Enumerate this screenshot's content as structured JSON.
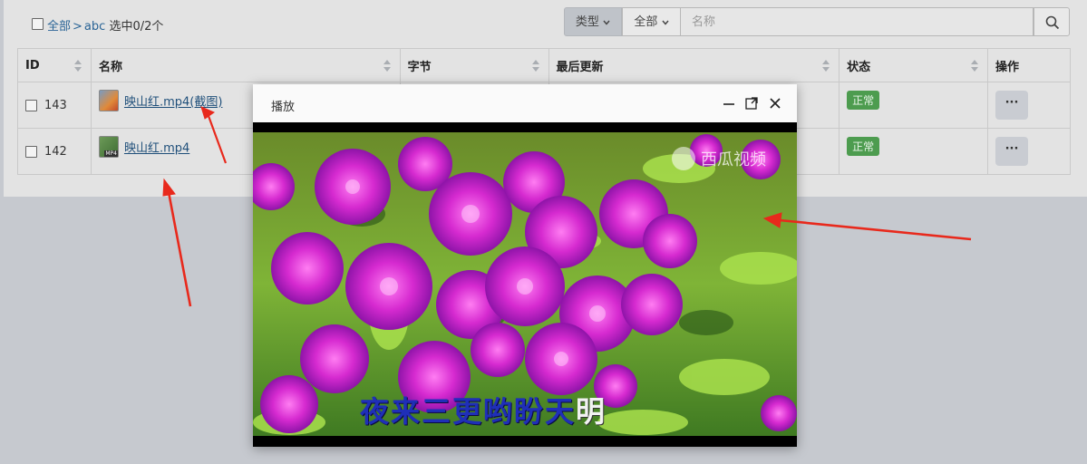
{
  "toolbar": {
    "breadcrumb_all": "全部",
    "breadcrumb_sep": ">",
    "breadcrumb_folder": "abc",
    "selection_status": "选中0/2个",
    "type_filter": "类型",
    "scope_filter": "全部",
    "search_placeholder": "名称"
  },
  "table": {
    "headers": [
      "ID",
      "名称",
      "字节",
      "最后更新",
      "状态",
      "操作"
    ],
    "rows": [
      {
        "id": "143",
        "name": "映山红.mp4(截图)",
        "status": "正常",
        "action": "···",
        "icon": "image-file-icon"
      },
      {
        "id": "142",
        "name": "映山红.mp4",
        "status": "正常",
        "action": "···",
        "icon": "mp4-file-icon"
      }
    ]
  },
  "modal": {
    "title": "播放",
    "video_subtitle_dim": "夜来三更哟盼天",
    "video_subtitle_bright": "明",
    "watermark": "西瓜视频"
  },
  "icons": {
    "search": "search-icon",
    "minimize": "minimize-icon",
    "maximize": "maximize-icon",
    "close": "close-icon",
    "dropdown": "chevron-down-icon"
  },
  "colors": {
    "link": "#2a6496",
    "status_ok": "#4d9c4f",
    "annotation_arrow": "#e8291c"
  }
}
